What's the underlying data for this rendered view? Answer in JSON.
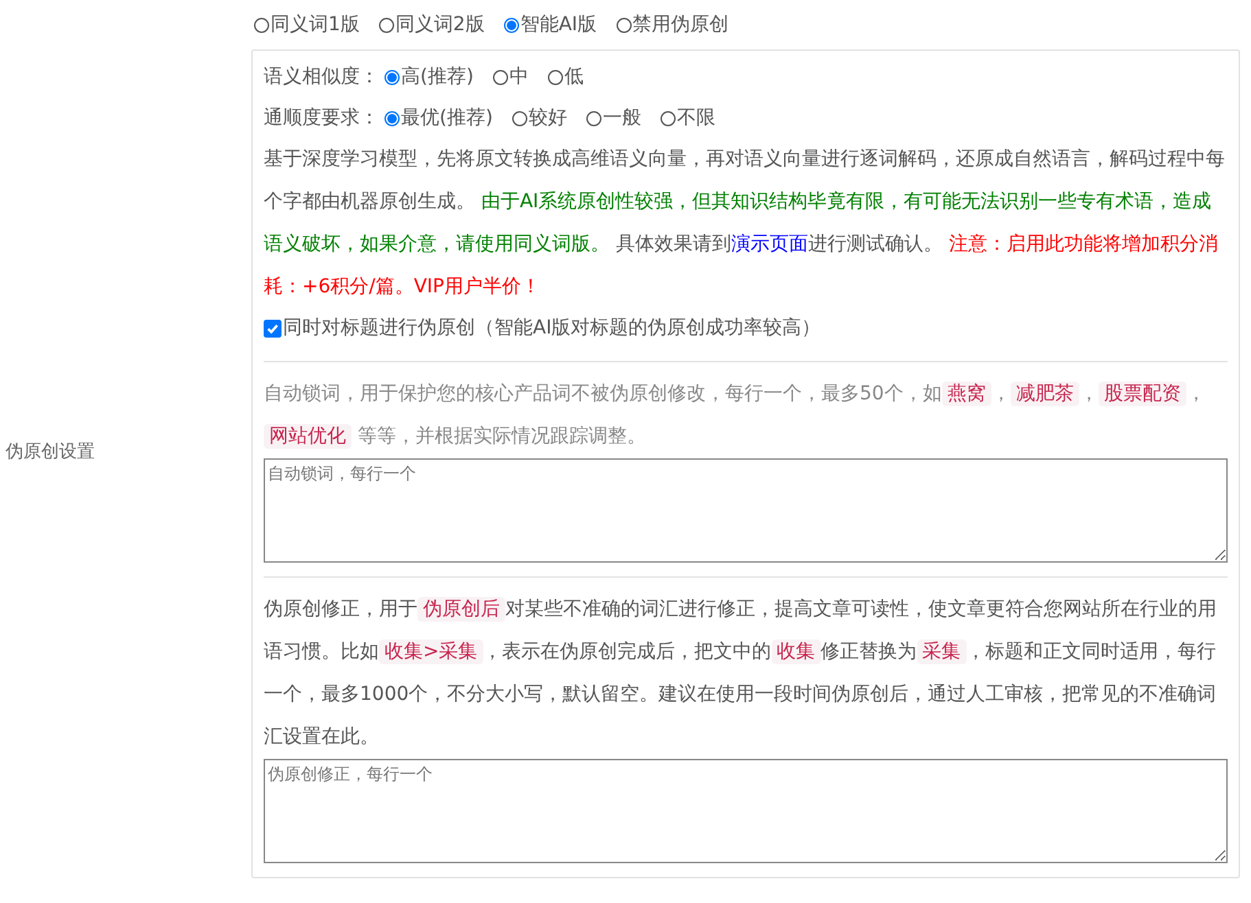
{
  "side_label": "伪原创设置",
  "versions": [
    {
      "label": "同义词1版",
      "selected": false
    },
    {
      "label": "同义词2版",
      "selected": false
    },
    {
      "label": "智能AI版",
      "selected": true
    },
    {
      "label": "禁用伪原创",
      "selected": false
    }
  ],
  "ai_settings": {
    "groups": [
      {
        "label": "语义相似度：",
        "options": [
          {
            "label": "高(推荐)",
            "selected": true
          },
          {
            "label": "中",
            "selected": false
          },
          {
            "label": "低",
            "selected": false
          }
        ]
      },
      {
        "label": "通顺度要求：",
        "options": [
          {
            "label": "最优(推荐)",
            "selected": true
          },
          {
            "label": "较好",
            "selected": false
          },
          {
            "label": "一般",
            "selected": false
          },
          {
            "label": "不限",
            "selected": false
          }
        ]
      }
    ],
    "description": [
      {
        "kind": "text",
        "text": "基于深度学习模型，先将原文转换成高维语义向量，再对语义向量进行逐词解码，还原成自然语言，解码过程中每个字都由机器原创生成。 "
      },
      {
        "kind": "green",
        "text": "由于AI系统原创性较强，但其知识结构毕竟有限，有可能无法识别一些专有术语，造成语义破坏，如果介意，请使用同义词版。"
      },
      {
        "kind": "text",
        "text": " 具体效果请到"
      },
      {
        "kind": "link",
        "text": "演示页面"
      },
      {
        "kind": "text",
        "text": "进行测试确认。 "
      },
      {
        "kind": "red",
        "text": "注意：启用此功能将增加积分消耗：+6积分/篇。VIP用户半价！"
      }
    ],
    "title_option": {
      "label": "同时对标题进行伪原创（智能AI版对标题的伪原创成功率较高）",
      "checked": true
    }
  },
  "lock_words": {
    "description": [
      {
        "kind": "text",
        "text": "自动锁词，用于保护您的核心产品词不被伪原创修改，每行一个，最多50个，如"
      },
      {
        "kind": "tag",
        "text": "燕窝"
      },
      {
        "kind": "text",
        "text": "，"
      },
      {
        "kind": "tag",
        "text": "减肥茶"
      },
      {
        "kind": "text",
        "text": "，"
      },
      {
        "kind": "tag",
        "text": "股票配资"
      },
      {
        "kind": "text",
        "text": "，"
      },
      {
        "kind": "tag",
        "text": "网站优化"
      },
      {
        "kind": "text",
        "text": " 等等，并根据实际情况跟踪调整。"
      }
    ],
    "textarea": {
      "placeholder": "自动锁词，每行一个"
    }
  },
  "corrections": {
    "description": [
      {
        "kind": "text",
        "text": "伪原创修正，用于"
      },
      {
        "kind": "tag",
        "text": "伪原创后"
      },
      {
        "kind": "text",
        "text": "对某些不准确的词汇进行修正，提高文章可读性，使文章更符合您网站所在行业的用语习惯。比如"
      },
      {
        "kind": "tag",
        "text": "收集>采集"
      },
      {
        "kind": "text",
        "text": "，表示在伪原创完成后，把文中的"
      },
      {
        "kind": "tag",
        "text": "收集"
      },
      {
        "kind": "text",
        "text": "修正替换为"
      },
      {
        "kind": "tag",
        "text": "采集"
      },
      {
        "kind": "text",
        "text": "，标题和正文同时适用，每行一个，最多1000个，不分大小写，默认留空。建议在使用一段时间伪原创后，通过人工审核，把常见的不准确词汇设置在此。"
      }
    ],
    "textarea": {
      "placeholder": "伪原创修正，每行一个"
    }
  }
}
